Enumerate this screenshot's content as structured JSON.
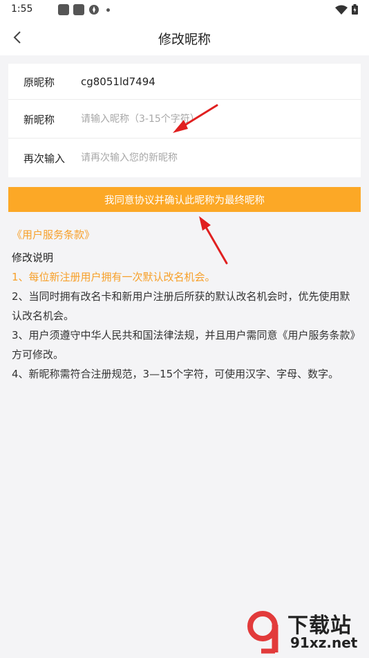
{
  "status_bar": {
    "time": "1:55"
  },
  "nav": {
    "title": "修改昵称"
  },
  "form": {
    "original_label": "原昵称",
    "original_value": "cg8051ld7494",
    "new_label": "新昵称",
    "new_placeholder": "请输入昵称（3-15个字符）",
    "confirm_label": "再次输入",
    "confirm_placeholder": "请再次输入您的新昵称"
  },
  "confirm_button": {
    "label": "我同意协议并确认此昵称为最终昵称"
  },
  "terms_link": "《用户服务条款》",
  "instructions": {
    "title": "修改说明",
    "items": [
      "1、每位新注册用户拥有一次默认改名机会。",
      "2、当同时拥有改名卡和新用户注册后所获的默认改名机会时，优先使用默认改名机会。",
      "3、用户须遵守中华人民共和国法律法规，并且用户需同意《用户服务条款》方可修改。",
      "4、新昵称需符合注册规范，3—15个字符，可使用汉字、字母、数字。"
    ]
  },
  "watermark": {
    "title": "下载站",
    "url": "91xz.net"
  },
  "colors": {
    "accent": "#fca826",
    "link": "#f7a02a",
    "annotation_arrow": "#e02020"
  },
  "icons": [
    "back-arrow-icon",
    "wifi-icon",
    "battery-icon",
    "notification-icon"
  ]
}
